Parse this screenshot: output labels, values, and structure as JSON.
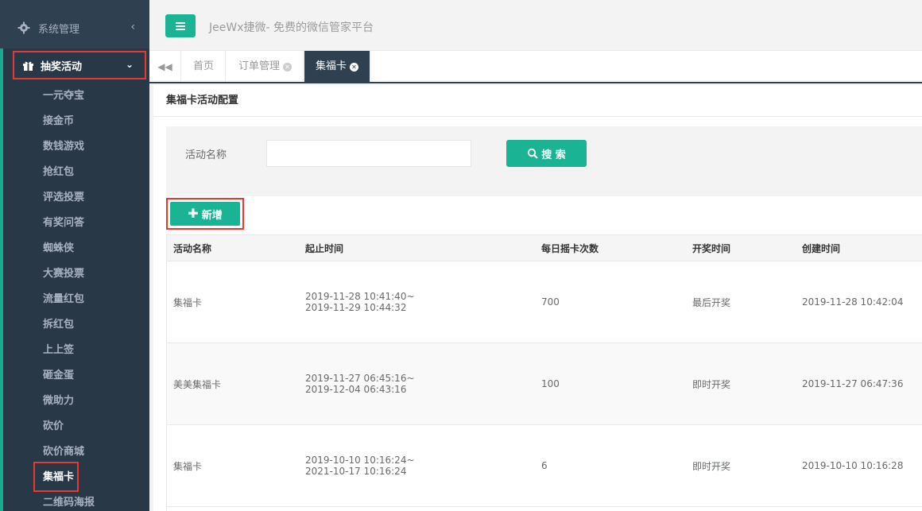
{
  "sidebar": {
    "system_label": "系统管理",
    "lottery_label": "抽奖活动",
    "items": [
      {
        "label": "一元夺宝"
      },
      {
        "label": "接金币"
      },
      {
        "label": "数钱游戏"
      },
      {
        "label": "抢红包"
      },
      {
        "label": "评选投票"
      },
      {
        "label": "有奖问答"
      },
      {
        "label": "蜘蛛侠"
      },
      {
        "label": "大赛投票"
      },
      {
        "label": "流量红包"
      },
      {
        "label": "拆红包"
      },
      {
        "label": "上上签"
      },
      {
        "label": "砸金蛋"
      },
      {
        "label": "微助力"
      },
      {
        "label": "砍价"
      },
      {
        "label": "砍价商城"
      },
      {
        "label": "集福卡"
      },
      {
        "label": "二维码海报"
      }
    ],
    "current_item": "集福卡"
  },
  "header": {
    "brand": "JeeWx捷微- 免费的微信管家平台"
  },
  "tabs": [
    {
      "label": "首页",
      "closable": false
    },
    {
      "label": "订单管理",
      "closable": true
    },
    {
      "label": "集福卡",
      "closable": true,
      "active": true
    }
  ],
  "panel": {
    "title": "集福卡活动配置",
    "search": {
      "label": "活动名称",
      "value": "",
      "placeholder": "",
      "button_label": "搜 索"
    },
    "add_button_label": "新增"
  },
  "table": {
    "columns": [
      "活动名称",
      "起止时间",
      "每日摇卡次数",
      "开奖时间",
      "创建时间"
    ],
    "rows": [
      {
        "name": "集福卡",
        "start": "2019-11-28 10:41:40~",
        "end": "2019-11-29 10:44:32",
        "daily": "700",
        "draw": "最后开奖",
        "created": "2019-11-28 10:42:04"
      },
      {
        "name": "美美集福卡",
        "start": "2019-11-27 06:45:16~",
        "end": "2019-12-04 06:43:16",
        "daily": "100",
        "draw": "即时开奖",
        "created": "2019-11-27 06:47:36"
      },
      {
        "name": "集福卡",
        "start": "2019-10-10 10:16:24~",
        "end": "2021-10-17 10:16:24",
        "daily": "6",
        "draw": "即时开奖",
        "created": "2019-10-10 10:16:28"
      }
    ]
  },
  "colors": {
    "sidebar_bg": "#2f4050",
    "accent": "#1ab394",
    "highlight_border": "#e53935"
  }
}
